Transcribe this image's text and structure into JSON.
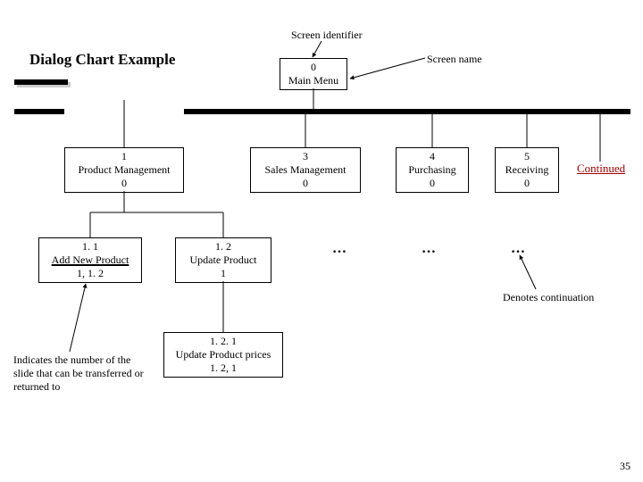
{
  "title": "Dialog Chart Example",
  "labels": {
    "screen_identifier": "Screen identifier",
    "screen_name": "Screen name"
  },
  "nodes": {
    "root": {
      "id": "0",
      "name": "Main Menu"
    },
    "n1": {
      "id": "1",
      "name": "Product Management",
      "ref": "0"
    },
    "n3": {
      "id": "3",
      "name": "Sales Management",
      "ref": "0"
    },
    "n4": {
      "id": "4",
      "name": "Purchasing",
      "ref": "0"
    },
    "n5": {
      "id": "5",
      "name": "Receiving",
      "ref": "0"
    },
    "n11": {
      "id": "1. 1",
      "name": "Add New Product",
      "ref": "1, 1. 2"
    },
    "n12": {
      "id": "1. 2",
      "name": "Update Product",
      "ref": "1"
    },
    "n121": {
      "id": "1. 2. 1",
      "name": "Update Product prices",
      "ref": "1. 2, 1"
    }
  },
  "continued": "Continued",
  "ellipsis": "…",
  "annotations": {
    "denotes": "Denotes continuation",
    "indicates": "Indicates the number of the slide that can be transferred or returned to"
  },
  "page_number": "35",
  "chart_data": {
    "type": "tree",
    "title": "Dialog Chart Example",
    "nodes": [
      {
        "id": "0",
        "label": "Main Menu",
        "children": [
          "1",
          "3",
          "4",
          "5",
          "continued"
        ]
      },
      {
        "id": "1",
        "label": "Product Management",
        "ref": "0",
        "children": [
          "1.1",
          "1.2"
        ]
      },
      {
        "id": "3",
        "label": "Sales Management",
        "ref": "0",
        "children": [
          "…"
        ]
      },
      {
        "id": "4",
        "label": "Purchasing",
        "ref": "0",
        "children": [
          "…"
        ]
      },
      {
        "id": "5",
        "label": "Receiving",
        "ref": "0",
        "children": [
          "…"
        ]
      },
      {
        "id": "continued",
        "label": "Continued"
      },
      {
        "id": "1.1",
        "label": "Add New Product",
        "ref": "1, 1.2"
      },
      {
        "id": "1.2",
        "label": "Update Product",
        "ref": "1",
        "children": [
          "1.2.1"
        ]
      },
      {
        "id": "1.2.1",
        "label": "Update Product prices",
        "ref": "1.2, 1"
      }
    ],
    "annotations": [
      {
        "text": "Screen identifier",
        "points_to": "node id"
      },
      {
        "text": "Screen name",
        "points_to": "node label"
      },
      {
        "text": "Denotes continuation",
        "points_to": "…"
      },
      {
        "text": "Indicates the number of the slide that can be transferred or returned to",
        "points_to": "node ref"
      }
    ]
  }
}
